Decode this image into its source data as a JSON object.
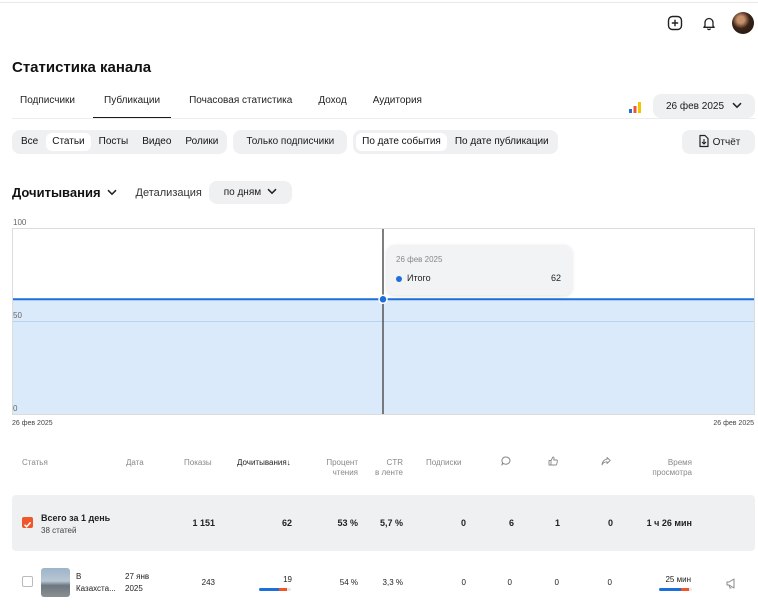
{
  "page": {
    "title": "Статистика канала"
  },
  "tabs": [
    {
      "label": "Подписчики",
      "active": false
    },
    {
      "label": "Публикации",
      "active": true
    },
    {
      "label": "Почасовая статистика",
      "active": false
    },
    {
      "label": "Доход",
      "active": false
    },
    {
      "label": "Аудитория",
      "active": false
    }
  ],
  "date_picker": {
    "value": "26 фев 2025"
  },
  "content_filter": {
    "options": [
      {
        "label": "Все",
        "active": false
      },
      {
        "label": "Статьи",
        "active": true
      },
      {
        "label": "Посты",
        "active": false
      },
      {
        "label": "Видео",
        "active": false
      },
      {
        "label": "Ролики",
        "active": false
      }
    ]
  },
  "subscribers_only": {
    "label": "Только подписчики"
  },
  "date_mode": {
    "options": [
      {
        "label": "По дате события",
        "active": true
      },
      {
        "label": "По дате публикации",
        "active": false
      }
    ]
  },
  "report_button": {
    "label": "Отчёт"
  },
  "metric": {
    "title": "Дочитывания",
    "detail_label": "Детализация",
    "detail_value": "по дням"
  },
  "chart_data": {
    "type": "area",
    "x": [
      "26 фев 2025"
    ],
    "series": [
      {
        "name": "Итого",
        "values": [
          62
        ]
      }
    ],
    "ylim": [
      0,
      100
    ],
    "yticks": [
      "100",
      "50",
      "0"
    ],
    "x_start_label": "26 фев 2025",
    "x_end_label": "26 фев 2025",
    "line_color": "#1e6fd9",
    "fill_color": "#dbeafb",
    "tooltip": {
      "date": "26 фев 2025",
      "label": "Итого",
      "value": "62"
    }
  },
  "table": {
    "headers": {
      "article": "Статья",
      "date": "Дата",
      "views": "Показы",
      "reads": "Дочитывания",
      "read_pct_1": "Процент",
      "read_pct_2": "чтения",
      "ctr_1": "CTR",
      "ctr_2": "в ленте",
      "subs": "Подписки",
      "time_1": "Время",
      "time_2": "просмотра"
    },
    "summary": {
      "title": "Всего за 1 день",
      "subtitle": "38 статей",
      "views": "1 151",
      "reads": "62",
      "read_pct": "53 %",
      "ctr": "5,7 %",
      "subs": "0",
      "comments": "6",
      "likes": "1",
      "shares": "0",
      "time": "1 ч 26 мин",
      "checked": true
    },
    "rows": [
      {
        "title_1": "В",
        "title_2": "Казахста...",
        "date_1": "27 янв",
        "date_2": "2025",
        "views": "243",
        "reads": "19",
        "read_pct": "54 %",
        "ctr": "3,3 %",
        "subs": "0",
        "comments": "0",
        "likes": "0",
        "shares": "0",
        "time": "25 мин",
        "reads_bar_fraction": 0.82,
        "time_bar_fraction": 0.85
      }
    ]
  },
  "colors": {
    "accent": "#f0562c",
    "blue": "#1e6fd9",
    "panel": "#eef0f2"
  }
}
